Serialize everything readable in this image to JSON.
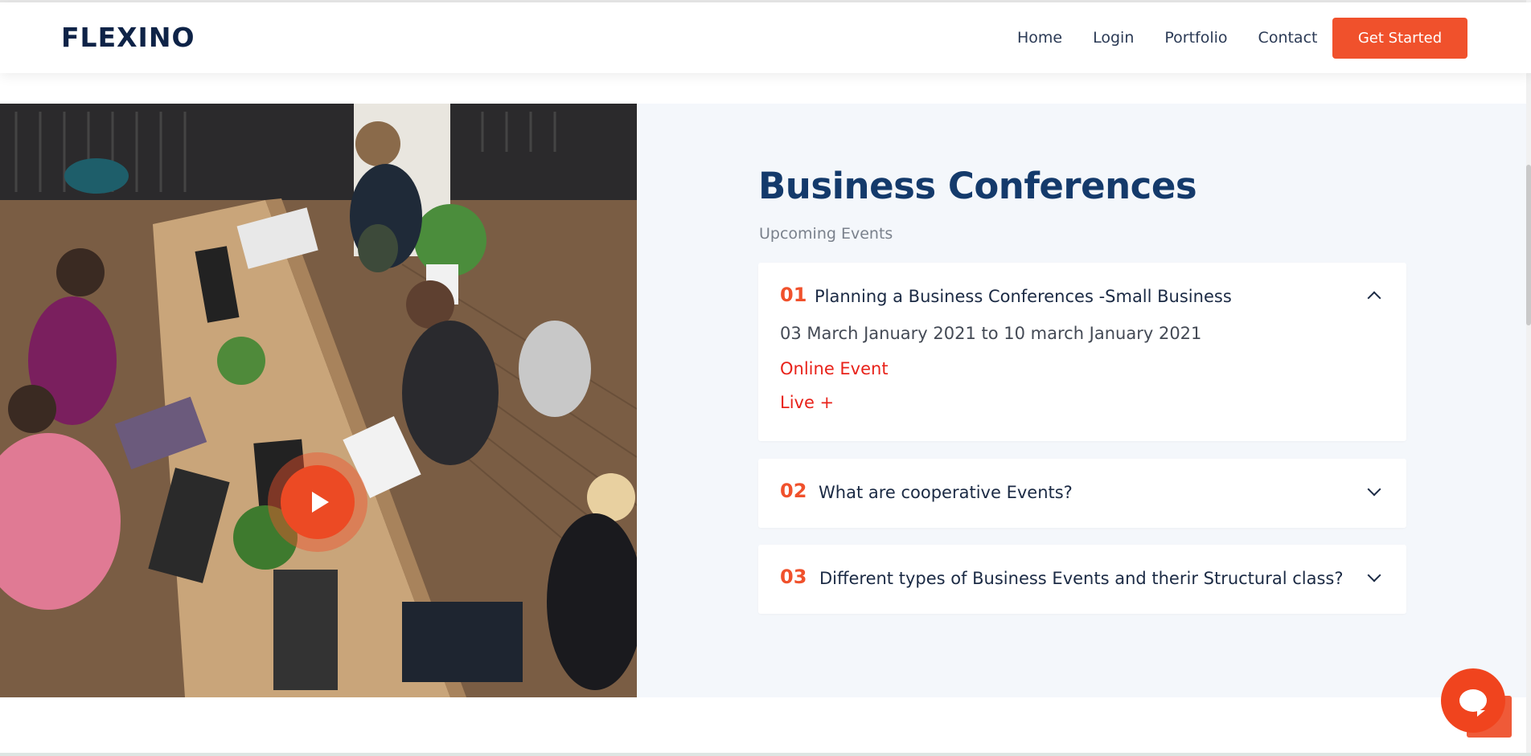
{
  "header": {
    "logo": "FLEXINO",
    "nav": [
      "Home",
      "Login",
      "Portfolio",
      "Contact"
    ],
    "cta_label": "Get Started"
  },
  "section": {
    "title": "Business Conferences",
    "subtitle": "Upcoming Events"
  },
  "accordion": [
    {
      "number": "01",
      "question": "Planning a Business Conferences -Small Business",
      "expanded": true,
      "date": "03 March January 2021 to 10 march January 2021",
      "event_type": "Online Event",
      "live_label": "Live +"
    },
    {
      "number": "02",
      "question": "What are cooperative Events?",
      "expanded": false
    },
    {
      "number": "03",
      "question": "Different types of Business Events and therir Structural class?",
      "expanded": false
    }
  ],
  "colors": {
    "accent": "#f0512c",
    "title": "#143a6b",
    "event_red": "#e8221a",
    "panel_bg": "#f4f7fb"
  },
  "icons": {
    "play": "play-icon",
    "chevron_up": "chevron-up-icon",
    "chevron_down": "chevron-down-icon",
    "chat": "chat-icon"
  }
}
